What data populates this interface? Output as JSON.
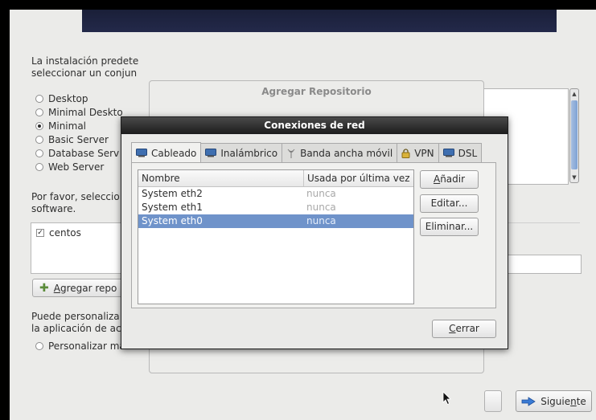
{
  "background_page": {
    "intro_line1": "La instalación predete",
    "intro_line2": "seleccionar un conjun",
    "install_options": [
      {
        "label": "Desktop",
        "selected": false
      },
      {
        "label": "Minimal Deskto",
        "selected": false
      },
      {
        "label": "Minimal",
        "selected": true
      },
      {
        "label": "Basic Server",
        "selected": false
      },
      {
        "label": "Database Serv",
        "selected": false
      },
      {
        "label": "Web Server",
        "selected": false
      }
    ],
    "select_line1": "Por favor, seleccio",
    "select_line2": "software.",
    "repo_item": "centos",
    "add_repo_prefix": "",
    "add_repo_access": "A",
    "add_repo_rest": "gregar repo",
    "customize_line1": "Puede personaliza",
    "customize_line2": "la aplicación de ac",
    "customize_option": "Personalizar más a",
    "next_prefix": "Siguie",
    "next_access": "n",
    "next_suffix": "te"
  },
  "repo_dialog": {
    "title": "Agregar Repositorio"
  },
  "network_dialog": {
    "title": "Conexiones de red",
    "tabs": [
      {
        "label": "Cableado",
        "icon": "wired-network-icon",
        "active": true
      },
      {
        "label": "Inalámbrico",
        "icon": "wireless-network-icon",
        "active": false
      },
      {
        "label": "Banda ancha móvil",
        "icon": "mobile-broadband-icon",
        "active": false
      },
      {
        "label": "VPN",
        "icon": "vpn-lock-icon",
        "active": false
      },
      {
        "label": "DSL",
        "icon": "dsl-network-icon",
        "active": false
      }
    ],
    "columns": {
      "name": "Nombre",
      "last_used": "Usada por última vez"
    },
    "connections": [
      {
        "name": "System eth2",
        "last_used": "nunca",
        "selected": false
      },
      {
        "name": "System eth1",
        "last_used": "nunca",
        "selected": false
      },
      {
        "name": "System eth0",
        "last_used": "nunca",
        "selected": true
      }
    ],
    "add_access": "A",
    "add_rest": "ñadir",
    "edit_label": "Editar...",
    "delete_label": "Eliminar...",
    "close_access": "C",
    "close_rest": "errar"
  },
  "colors": {
    "selection": "#6f93ca",
    "title_bar": "#1c1c1c",
    "banner": "#1a1f38",
    "window_bg": "#ebebe9"
  }
}
